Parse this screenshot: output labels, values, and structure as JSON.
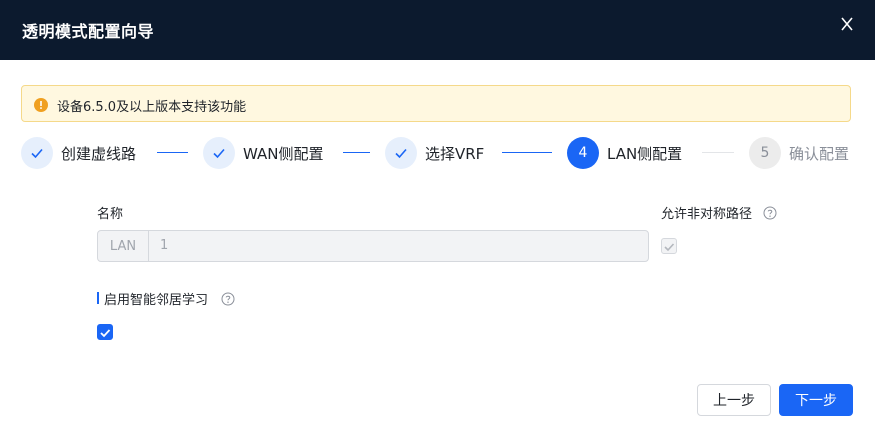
{
  "dialog": {
    "title": "透明模式配置向导"
  },
  "alert": {
    "text": "设备6.5.0及以上版本支持该功能",
    "icon": "warning-icon"
  },
  "steps": [
    {
      "number": "1",
      "label": "创建虚线路",
      "status": "done"
    },
    {
      "number": "2",
      "label": "WAN侧配置",
      "status": "done"
    },
    {
      "number": "3",
      "label": "选择VRF",
      "status": "done"
    },
    {
      "number": "4",
      "label": "LAN侧配置",
      "status": "active"
    },
    {
      "number": "5",
      "label": "确认配置",
      "status": "pending"
    }
  ],
  "form": {
    "name_label": "名称",
    "name_prefix": "LAN",
    "name_value": "1",
    "asymmetric_label": "允许非对称路径",
    "asymmetric_checked": true,
    "asymmetric_disabled": true,
    "smart_neighbor_label": "启用智能邻居学习",
    "smart_neighbor_checked": true
  },
  "buttons": {
    "prev": "上一步",
    "next": "下一步"
  },
  "colors": {
    "primary": "#1a66f5",
    "header": "#0c1a2e",
    "alert_bg": "#fff8e0",
    "alert_icon": "#f0a020"
  }
}
